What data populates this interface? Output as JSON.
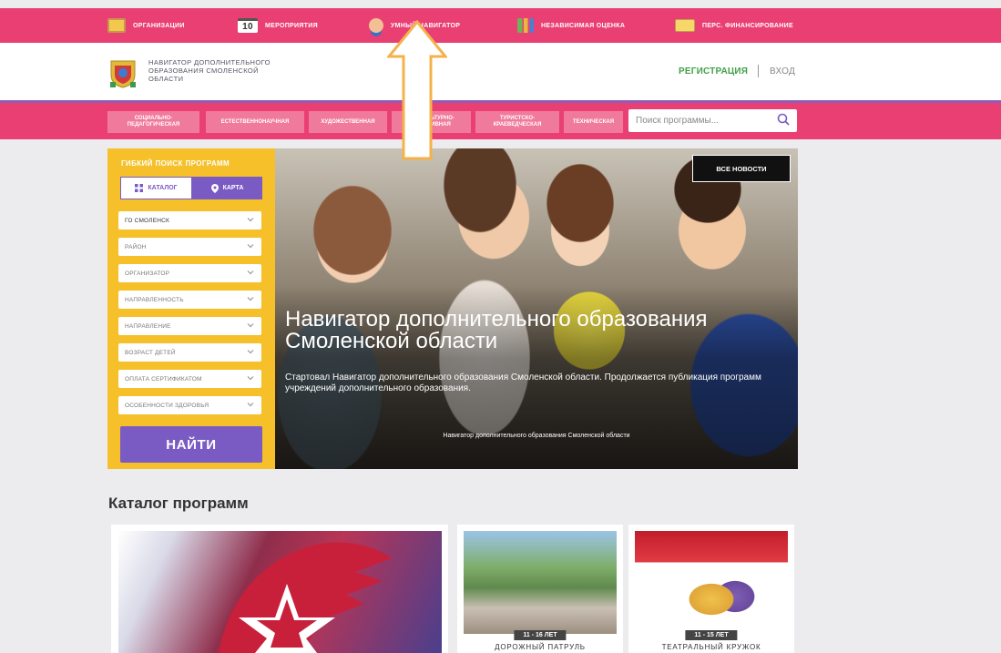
{
  "topbar": {
    "items": [
      {
        "label": "ОРГАНИЗАЦИИ",
        "icon": "organizations-icon"
      },
      {
        "label": "МЕРОПРИЯТИЯ",
        "icon": "calendar-icon",
        "badge": "10"
      },
      {
        "label": "УМНЫЙ НАВИГАТОР",
        "icon": "smart-navigator-icon"
      },
      {
        "label": "НЕЗАВИСИМАЯ ОЦЕНКА",
        "icon": "chart-icon"
      },
      {
        "label": "ПЕРС. ФИНАНСИРОВАНИЕ",
        "icon": "money-icon"
      }
    ]
  },
  "header": {
    "logo_text": "НАВИГАТОР ДОПОЛНИТЕЛЬНОГО ОБРАЗОВАНИЯ СМОЛЕНСКОЙ ОБЛАСТИ",
    "register": "РЕГИСТРАЦИЯ",
    "login": "ВХОД"
  },
  "nav": {
    "tabs": [
      {
        "label": "СОЦИАЛЬНО-ПЕДАГОГИЧЕСКАЯ"
      },
      {
        "label": "ЕСТЕСТВЕННОНАУЧНАЯ"
      },
      {
        "label": "ХУДОЖЕСТВЕННАЯ"
      },
      {
        "label": "ФИЗКУЛЬТУРНО-СПОРТИВНАЯ"
      },
      {
        "label": "ТУРИСТСКО-КРАЕВЕДЧЕСКАЯ"
      },
      {
        "label": "ТЕХНИЧЕСКАЯ"
      }
    ],
    "search_placeholder": "Поиск программы..."
  },
  "filter": {
    "title": "ГИБКИЙ ПОИСК ПРОГРАММ",
    "catalog_tab": "КАТАЛОГ",
    "map_tab": "КАРТА",
    "selects": [
      "ГО СМОЛЕНСК",
      "РАЙОН",
      "ОРГАНИЗАТОР",
      "НАПРАВЛЕННОСТЬ",
      "НАПРАВЛЕНИЕ",
      "ВОЗРАСТ ДЕТЕЙ",
      "ОПЛАТА СЕРТИФИКАТОМ",
      "ОСОБЕННОСТИ ЗДОРОВЬЯ"
    ],
    "find_button": "НАЙТИ"
  },
  "hero": {
    "news_button": "ВСЕ НОВОСТИ",
    "title": "Навигатор дополнительного образования Смоленской области",
    "subtitle": "Стартовал Навигатор дополнительного образования Смоленской области. Продолжается публикация программ учреждений дополнительного образования.",
    "caption": "Навигатор дополнительного образования Смоленской области"
  },
  "catalog": {
    "title": "Каталог программ",
    "cards": [
      {
        "name": "ДОРОЖНЫЙ ПАТРУЛЬ",
        "age": "11 - 16 ЛЕТ"
      },
      {
        "name": "ТЕАТРАЛЬНЫЙ КРУЖОК",
        "age": "11 - 15 ЛЕТ"
      }
    ]
  },
  "colors": {
    "pink": "#ea3f73",
    "purple": "#7a5bc4",
    "yellow": "#f5c02a",
    "green": "#43a047"
  }
}
